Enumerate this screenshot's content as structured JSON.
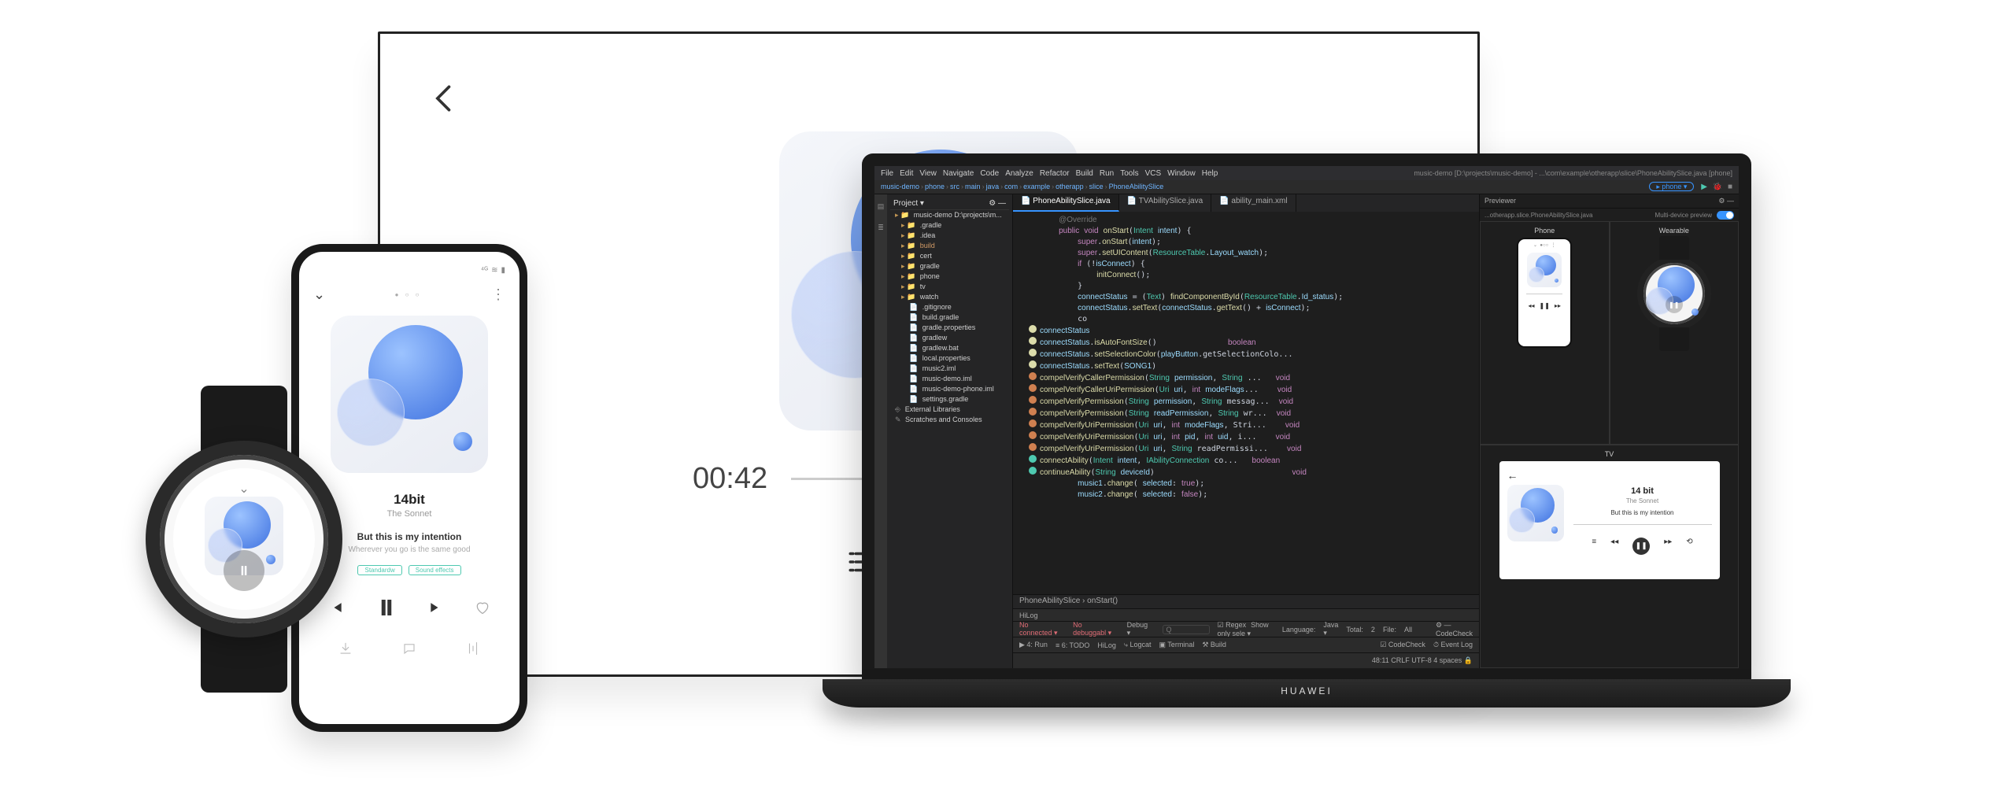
{
  "tv": {
    "time_elapsed": "00:42"
  },
  "phone": {
    "status": {
      "signal": "⁴ᴳ",
      "wifi": "≋",
      "battery": "▮"
    },
    "page_dots": "● ○ ○",
    "title": "14bit",
    "artist": "The Sonnet",
    "lyric_current": "But this is my intention",
    "lyric_next": "Wherever you go is the same good",
    "pill1": "Standardw",
    "pill2": "Sound effects"
  },
  "watch": {},
  "laptop": {
    "brand": "HUAWEI"
  },
  "ide": {
    "menus": [
      "File",
      "Edit",
      "View",
      "Navigate",
      "Code",
      "Analyze",
      "Refactor",
      "Build",
      "Run",
      "Tools",
      "VCS",
      "Window",
      "Help"
    ],
    "title_path": "music-demo [D:\\projects\\music-demo] - ...\\com\\example\\otherapp\\slice\\PhoneAbilitySlice.java [phone]",
    "run_config": "▸ phone ▾",
    "breadcrumbs": [
      "music-demo",
      "phone",
      "src",
      "main",
      "java",
      "com",
      "example",
      "otherapp",
      "slice",
      "PhoneAbilitySlice"
    ],
    "tree_header": "Project ▾",
    "tree": [
      {
        "depth": 0,
        "icon": "folder",
        "label": "music-demo",
        "suffix": "D:\\projects\\m..."
      },
      {
        "depth": 1,
        "icon": "folder",
        "label": ".gradle"
      },
      {
        "depth": 1,
        "icon": "folder",
        "label": ".idea"
      },
      {
        "depth": 1,
        "icon": "folder",
        "label": "build",
        "special": true
      },
      {
        "depth": 1,
        "icon": "folder",
        "label": "cert"
      },
      {
        "depth": 1,
        "icon": "folder",
        "label": "gradle"
      },
      {
        "depth": 1,
        "icon": "folder",
        "label": "phone"
      },
      {
        "depth": 1,
        "icon": "folder",
        "label": "tv"
      },
      {
        "depth": 1,
        "icon": "folder",
        "label": "watch"
      },
      {
        "depth": 2,
        "icon": "file",
        "label": ".gitignore"
      },
      {
        "depth": 2,
        "icon": "file",
        "label": "build.gradle"
      },
      {
        "depth": 2,
        "icon": "file",
        "label": "gradle.properties"
      },
      {
        "depth": 2,
        "icon": "file",
        "label": "gradlew"
      },
      {
        "depth": 2,
        "icon": "file",
        "label": "gradlew.bat"
      },
      {
        "depth": 2,
        "icon": "file",
        "label": "local.properties"
      },
      {
        "depth": 2,
        "icon": "file",
        "label": "music2.iml"
      },
      {
        "depth": 2,
        "icon": "file",
        "label": "music-demo.iml"
      },
      {
        "depth": 2,
        "icon": "file",
        "label": "music-demo-phone.iml"
      },
      {
        "depth": 2,
        "icon": "file",
        "label": "settings.gradle"
      },
      {
        "depth": 0,
        "icon": "lib",
        "label": "External Libraries"
      },
      {
        "depth": 0,
        "icon": "scratch",
        "label": "Scratches and Consoles"
      }
    ],
    "tabs": [
      {
        "label": "PhoneAbilitySlice.java",
        "active": true
      },
      {
        "label": "TVAbilitySlice.java",
        "active": false
      },
      {
        "label": "ability_main.xml",
        "active": false
      }
    ],
    "code_lines": [
      {
        "g": "",
        "t": "    @Override"
      },
      {
        "g": "",
        "t": "    public void onStart(Intent intent) {"
      },
      {
        "g": "",
        "t": "        super.onStart(intent);"
      },
      {
        "g": "",
        "t": "        super.setUIContent(ResourceTable.Layout_watch);"
      },
      {
        "g": "",
        "t": "        if (!isConnect) {"
      },
      {
        "g": "",
        "t": "            initConnect();"
      },
      {
        "g": "",
        "t": "        }"
      },
      {
        "g": "",
        "t": "        connectStatus = (Text) findComponentById(ResourceTable.Id_status);"
      },
      {
        "g": "",
        "t": "        connectStatus.setText(connectStatus.getText() + isConnect);"
      },
      {
        "g": "",
        "t": "        co"
      },
      {
        "g": "y",
        "t": "connectStatus"
      },
      {
        "g": "y",
        "t": "connectStatus.isAutoFontSize()               boolean"
      },
      {
        "g": "y",
        "t": "connectStatus.setSelectionColor(playButton.getSelectionColo..."
      },
      {
        "g": "y",
        "t": "connectStatus.setText(SONG1)"
      },
      {
        "g": "o",
        "t": "compelVerifyCallerPermission(String permission, String ...   void"
      },
      {
        "g": "o",
        "t": "compelVerifyCallerUriPermission(Uri uri, int modeFlags...    void"
      },
      {
        "g": "o",
        "t": "compelVerifyPermission(String permission, String messag...  void"
      },
      {
        "g": "o",
        "t": "compelVerifyPermission(String readPermission, String wr...  void"
      },
      {
        "g": "o",
        "t": "compelVerifyUriPermission(Uri uri, int modeFlags, Stri...    void"
      },
      {
        "g": "o",
        "t": "compelVerifyUriPermission(Uri uri, int pid, int uid, i...    void"
      },
      {
        "g": "o",
        "t": "compelVerifyUriPermission(Uri uri, String readPermissi...    void"
      },
      {
        "g": "g",
        "t": "connectAbility(Intent intent, IAbilityConnection co...   boolean"
      },
      {
        "g": "g",
        "t": "continueAbility(String deviceId)                             void"
      },
      {
        "g": "",
        "t": "        music1.change( selected: true);"
      },
      {
        "g": "",
        "t": "        music2.change( selected: false);"
      }
    ],
    "editor_breadcrumb": "PhoneAbilitySlice  ›  onStart()",
    "hilog_label": "HiLog",
    "previewer": {
      "head_label": "Previewer",
      "sub_left": "...otherapp.slice.PhoneAbilitySlice.java",
      "sub_right": "Multi-device preview",
      "cells": {
        "phone": "Phone",
        "wearable": "Wearable",
        "tv": "TV"
      },
      "tv_preview": {
        "title": "14 bit",
        "artist": "The Sonnet",
        "lyric": "But this is my intention"
      }
    },
    "panel1": {
      "left": [
        "No connected ▾",
        "No debuggabl ▾",
        "Debug ▾"
      ],
      "search_placeholder": "Q",
      "mid": [
        "☑ Regex",
        "Show only sele ▾"
      ],
      "lang_label": "Language:",
      "lang_value": "Java ▾",
      "total_label": "Total:",
      "total_value": "2",
      "file_label": "File:",
      "file_value": "All",
      "right": "⚙ — CodeCheck"
    },
    "panel2": {
      "left": [
        "▶ 4: Run",
        "≡ 6: TODO",
        "HiLog",
        "⤷ Logcat",
        "▣ Terminal",
        "⚒ Build"
      ],
      "right": [
        "☑ CodeCheck",
        "⏱ Event Log"
      ]
    },
    "statusbar": "48:11   CRLF   UTF-8   4 spaces   🔒"
  }
}
